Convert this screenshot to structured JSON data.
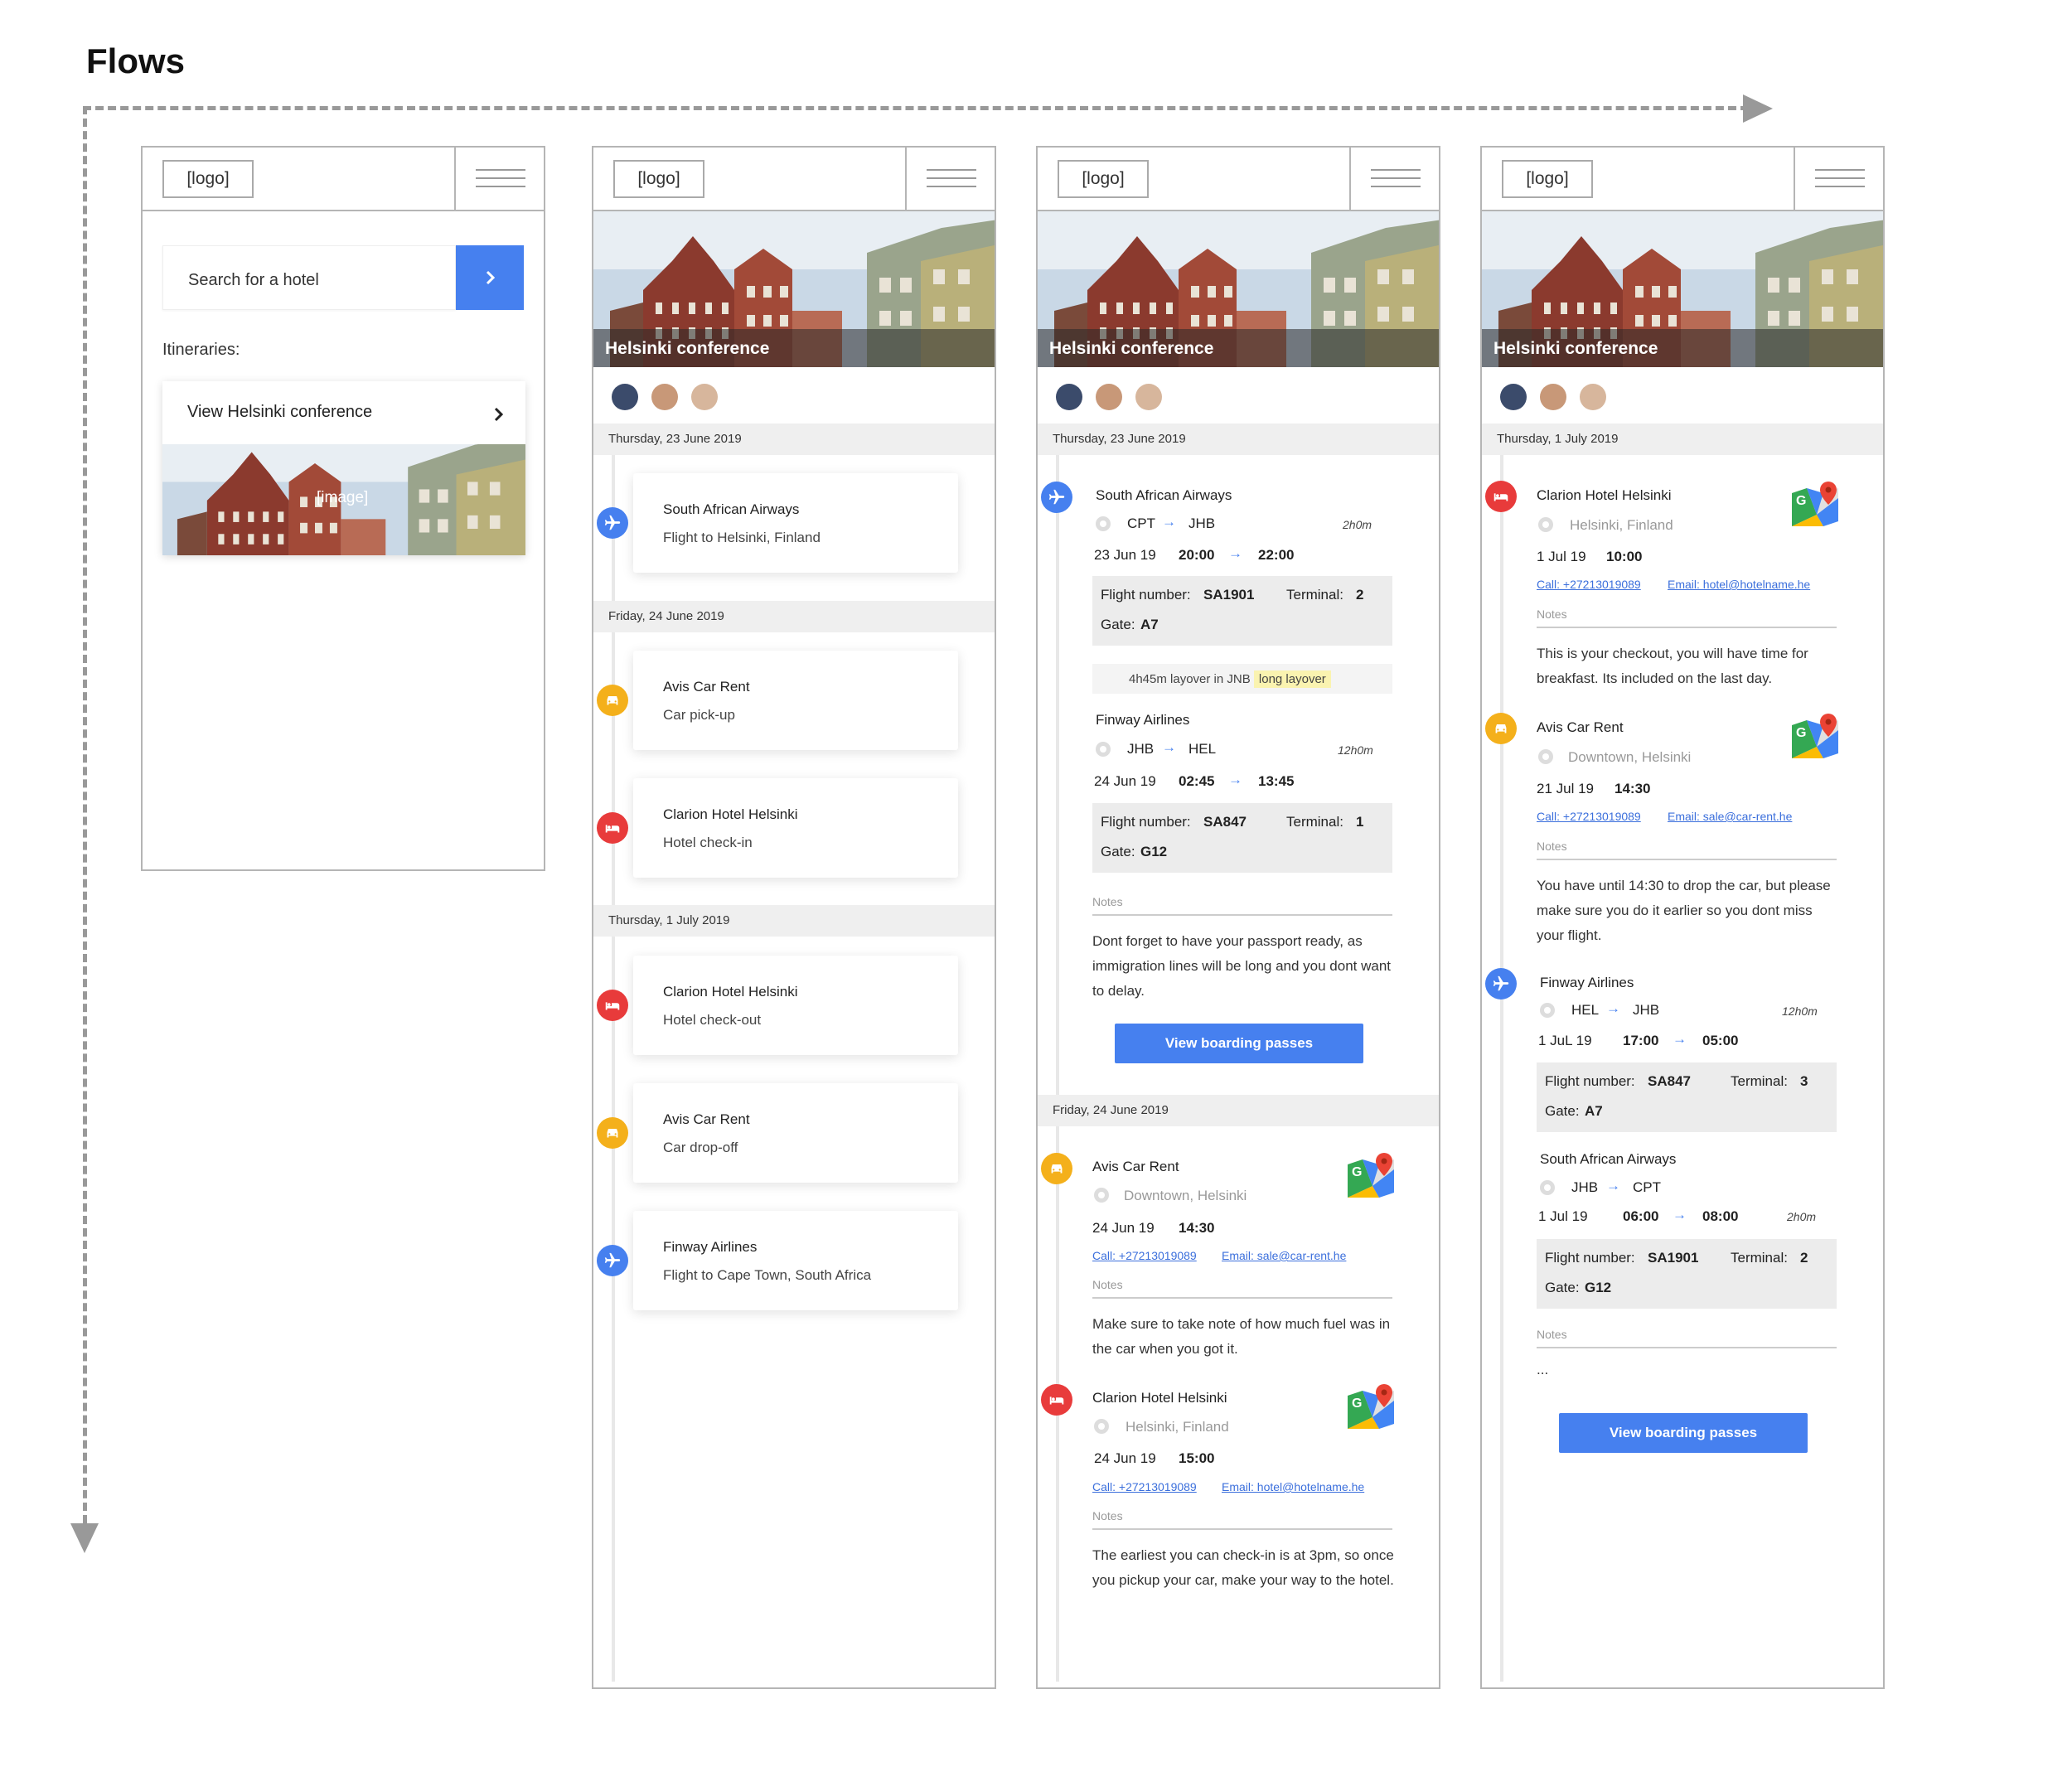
{
  "page": {
    "title": "Flows"
  },
  "common": {
    "logo": "[logo]",
    "hero_title": "Helsinki conference",
    "notes": "Notes",
    "boarding_btn": "View boarding passes",
    "arrow": "→"
  },
  "screen1": {
    "search_placeholder": "Search for a hotel",
    "itineraries_label": "Itineraries:",
    "card_title": "View Helsinki conference",
    "image_placeholder": "[image]"
  },
  "screen2": {
    "dates": [
      "Thursday, 23 June 2019",
      "Friday, 24 June 2019",
      "Thursday, 1 July 2019"
    ],
    "items": [
      {
        "title": "South African Airways",
        "subtitle": "Flight to Helsinki, Finland"
      },
      {
        "title": "Avis Car Rent",
        "subtitle": "Car pick-up"
      },
      {
        "title": "Clarion Hotel Helsinki",
        "subtitle": "Hotel check-in"
      },
      {
        "title": "Clarion Hotel Helsinki",
        "subtitle": "Hotel check-out"
      },
      {
        "title": "Avis Car Rent",
        "subtitle": "Car drop-off"
      },
      {
        "title": "Finway Airlines",
        "subtitle": "Flight to Cape Town, South Africa"
      }
    ]
  },
  "screen3": {
    "date1": "Thursday, 23 June 2019",
    "flight1": {
      "airline": "South African Airways",
      "from": "CPT",
      "to": "JHB",
      "duration": "2h0m",
      "date": "23 Jun 19",
      "dep": "20:00",
      "arr": "22:00",
      "flight_label": "Flight number:",
      "flight_no": "SA1901",
      "terminal_label": "Terminal:",
      "terminal": "2",
      "gate_label": "Gate:",
      "gate": "A7"
    },
    "layover": {
      "text": "4h45m layover in JNB",
      "tag": "long layover"
    },
    "flight2": {
      "airline": "Finway Airlines",
      "from": "JHB",
      "to": "HEL",
      "duration": "12h0m",
      "date": "24 Jun 19",
      "dep": "02:45",
      "arr": "13:45",
      "flight_label": "Flight number:",
      "flight_no": "SA847",
      "terminal_label": "Terminal:",
      "terminal": "1",
      "gate_label": "Gate:",
      "gate": "G12"
    },
    "notes_text": "Dont forget to have your passport ready, as immigration lines will be long and you dont want to delay.",
    "date2": "Friday, 24 June 2019",
    "car": {
      "name": "Avis Car Rent",
      "location": "Downtown, Helsinki",
      "date": "24 Jun 19",
      "time": "14:30",
      "call": "Call: +27213019089",
      "email": "Email: sale@car-rent.he",
      "notes_text": "Make sure to take note of how much fuel was in the car when you got it."
    },
    "hotel": {
      "name": "Clarion Hotel Helsinki",
      "location": "Helsinki, Finland",
      "date": "24 Jun 19",
      "time": "15:00",
      "call": "Call: +27213019089",
      "email": "Email: hotel@hotelname.he",
      "notes_text": "The earliest you can check-in is at 3pm, so once you pickup your car, make your way to the hotel."
    }
  },
  "screen4": {
    "date": "Thursday, 1 July 2019",
    "hotel": {
      "name": "Clarion Hotel Helsinki",
      "location": "Helsinki, Finland",
      "date": "1 Jul 19",
      "time": "10:00",
      "call": "Call: +27213019089",
      "email": "Email: hotel@hotelname.he",
      "notes_text": "This is your checkout, you will have time for breakfast. Its included on the last day."
    },
    "car": {
      "name": "Avis Car Rent",
      "location": "Downtown, Helsinki",
      "date": "21 Jul 19",
      "time": "14:30",
      "call": "Call: +27213019089",
      "email": "Email: sale@car-rent.he",
      "notes_text": "You have until 14:30 to drop the car, but please make sure you do it earlier so you dont miss your flight."
    },
    "flight1": {
      "airline": "Finway Airlines",
      "from": "HEL",
      "to": "JHB",
      "duration": "12h0m",
      "date": "1 JuL 19",
      "dep": "17:00",
      "arr": "05:00",
      "flight_label": "Flight number:",
      "flight_no": "SA847",
      "terminal_label": "Terminal:",
      "terminal": "3",
      "gate_label": "Gate:",
      "gate": "A7"
    },
    "flight2": {
      "airline": "South African Airways",
      "from": "JHB",
      "to": "CPT",
      "duration": "2h0m",
      "date": "1 Jul 19",
      "dep": "06:00",
      "arr": "08:00",
      "flight_label": "Flight number:",
      "flight_no": "SA1901",
      "terminal_label": "Terminal:",
      "terminal": "2",
      "gate_label": "Gate:",
      "gate": "G12"
    },
    "notes_text": "..."
  }
}
